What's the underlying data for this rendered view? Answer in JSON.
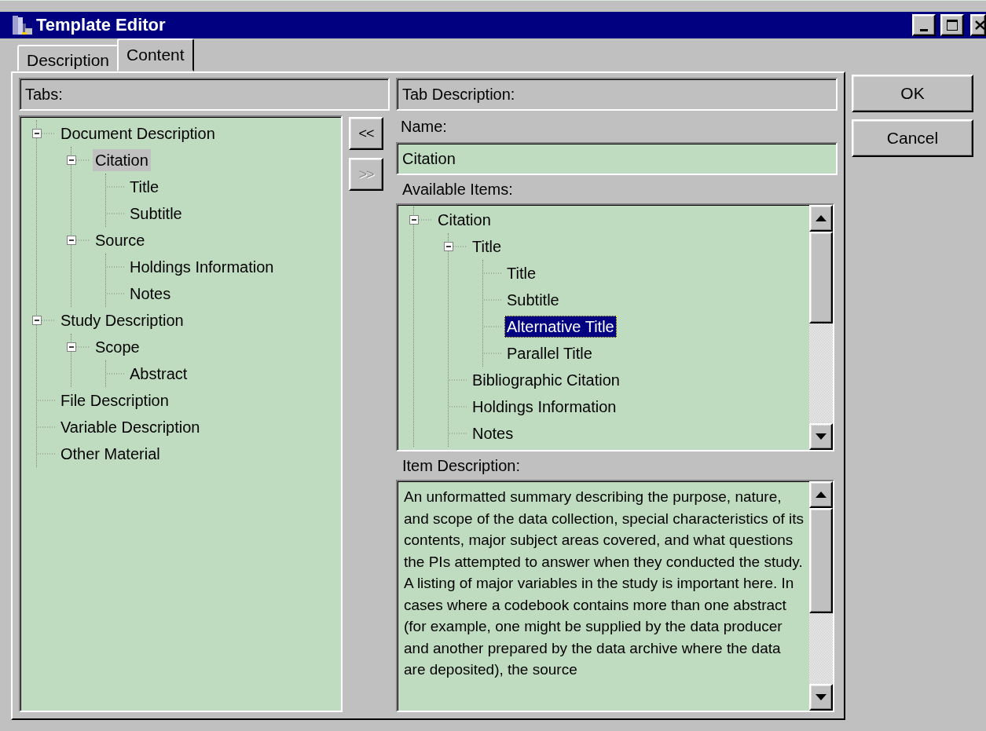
{
  "window": {
    "title": "Template Editor"
  },
  "tabs": [
    {
      "label": "Description",
      "selected": false
    },
    {
      "label": "Content",
      "selected": true
    }
  ],
  "tabs_panel": {
    "header": "Tabs:",
    "tree": [
      {
        "label": "Document Description",
        "selected": false,
        "expanded": true,
        "children": [
          {
            "label": "Citation",
            "selected": true,
            "expanded": true,
            "children": [
              {
                "label": "Title",
                "selected": false
              },
              {
                "label": "Subtitle",
                "selected": false
              }
            ]
          },
          {
            "label": "Source",
            "selected": false,
            "expanded": true,
            "children": [
              {
                "label": "Holdings Information",
                "selected": false
              },
              {
                "label": "Notes",
                "selected": false
              }
            ]
          }
        ]
      },
      {
        "label": "Study Description",
        "selected": false,
        "expanded": true,
        "children": [
          {
            "label": "Scope",
            "selected": false,
            "expanded": true,
            "children": [
              {
                "label": "Abstract",
                "selected": false
              }
            ]
          }
        ]
      },
      {
        "label": "File Description",
        "selected": false
      },
      {
        "label": "Variable Description",
        "selected": false
      },
      {
        "label": "Other Material",
        "selected": false
      }
    ]
  },
  "move_buttons": [
    {
      "label": "<<",
      "disabled": false
    },
    {
      "label": ">>",
      "disabled": true
    }
  ],
  "tab_description": {
    "header": "Tab Description:",
    "name_label": "Name:",
    "name_value": "Citation",
    "available_label": "Available Items:",
    "available_tree": [
      {
        "label": "Citation",
        "selected": false,
        "expanded": true,
        "children": [
          {
            "label": "Title",
            "selected": false,
            "expanded": true,
            "children": [
              {
                "label": "Title",
                "selected": false
              },
              {
                "label": "Subtitle",
                "selected": false
              },
              {
                "label": "Alternative Title",
                "selected": true
              },
              {
                "label": "Parallel Title",
                "selected": false
              }
            ]
          },
          {
            "label": "Bibliographic Citation",
            "selected": false
          },
          {
            "label": "Holdings Information",
            "selected": false
          },
          {
            "label": "Notes",
            "selected": false
          }
        ]
      }
    ],
    "item_description_label": "Item Description:",
    "item_description": "An unformatted summary describing the purpose, nature, and scope of the data collection, special characteristics of its contents, major subject areas covered, and what questions the PIs attempted to answer when they conducted the study. A listing of major variables in the study is important here. In cases where a codebook contains more than one abstract (for example, one might be supplied by the data producer and another prepared by the data archive where the data are deposited), the source"
  },
  "buttons": [
    {
      "label": "OK"
    },
    {
      "label": "Cancel"
    }
  ]
}
